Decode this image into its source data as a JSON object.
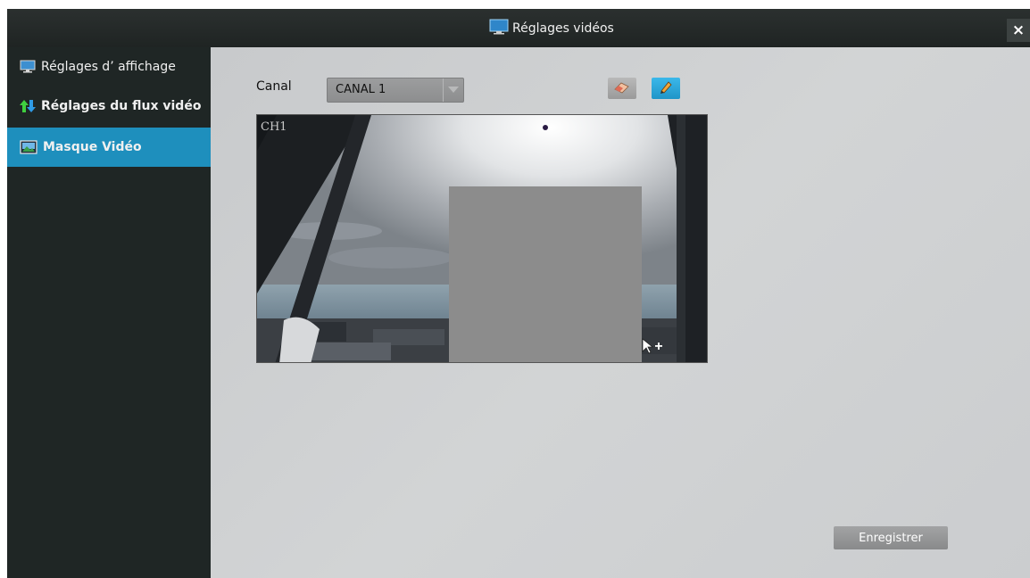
{
  "window": {
    "title": "Réglages vidéos",
    "close_label": "×"
  },
  "sidebar": {
    "items": [
      {
        "label": "Réglages d’ affichage",
        "icon": "monitor-icon",
        "active": false
      },
      {
        "label": "Réglages du flux vidéo",
        "icon": "up-down-arrows-icon",
        "active": false
      },
      {
        "label": "Masque Vidéo",
        "icon": "picture-icon",
        "active": true
      }
    ]
  },
  "main": {
    "canal_label": "Canal",
    "canal_value": "CANAL 1",
    "tools": {
      "eraser_icon": "eraser-icon",
      "pencil_icon": "pencil-icon"
    },
    "preview": {
      "channel_overlay": "CH1"
    },
    "save_label": "Enregistrer"
  },
  "colors": {
    "titlebar": "#252a29",
    "sidebar": "#1f2625",
    "active_item": "#1e8fbd",
    "content_bg": "#cfd1d3",
    "mask": "#8c8c8c"
  }
}
